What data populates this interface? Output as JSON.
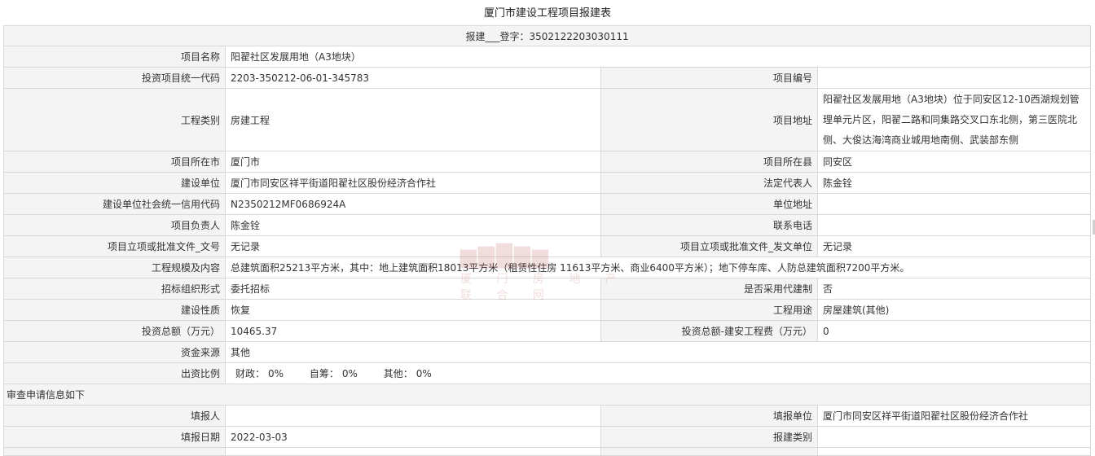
{
  "page_title": "厦门市建设工程项目报建表",
  "registration": "报建___登字：3502122203030111",
  "rows": {
    "project_name_label": "项目名称",
    "project_name": "阳翟社区发展用地（A3地块）",
    "invest_code_label": "投资项目统一代码",
    "invest_code": "2203-350212-06-01-345783",
    "project_no_label": "项目编号",
    "project_no": "",
    "category_label": "工程类别",
    "category": "房建工程",
    "address_label": "项目地址",
    "address": "阳翟社区发展用地（A3地块）位于同安区12-10西湖规划管理单元片区，阳翟二路和同集路交叉口东北侧，第三医院北侧、大俊达海湾商业城用地南侧、武装部东侧",
    "city_label": "项目所在市",
    "city": "厦门市",
    "county_label": "项目所在县",
    "county": "同安区",
    "builder_label": "建设单位",
    "builder": "厦门市同安区祥平街道阳翟社区股份经济合作社",
    "legal_rep_label": "法定代表人",
    "legal_rep": "陈金铨",
    "credit_code_label": "建设单位社会统一信用代码",
    "credit_code": "N2350212MF0686924A",
    "unit_address_label": "单位地址",
    "unit_address": "",
    "manager_label": "项目负责人",
    "manager": "陈金铨",
    "phone_label": "联系电话",
    "phone": "",
    "approval_doc_label": "项目立项或批准文件_文号",
    "approval_doc": "无记录",
    "approval_unit_label": "项目立项或批准文件_发文单位",
    "approval_unit": "无记录",
    "scale_label": "工程规模及内容",
    "scale": "总建筑面积25213平方米，其中：地上建筑面积18013平方米（租赁性住房 11613平方米、商业6400平方米）；地下停车库、人防总建筑面积7200平方米。",
    "bidding_label": "招标组织形式",
    "bidding": "委托招标",
    "agent_label": "是否采用代建制",
    "agent": "否",
    "nature_label": "建设性质",
    "nature": "恢复",
    "usage_label": "工程用途",
    "usage": "房屋建筑(其他)",
    "invest_total_label": "投资总额（万元）",
    "invest_total": "10465.37",
    "invest_build_label": "投资总额-建安工程费（万元）",
    "invest_build": "0",
    "fund_source_label": "资金来源",
    "fund_source": "其他",
    "ratio_label": "出资比例",
    "ratio_fin_label": "财政：",
    "ratio_fin": "0%",
    "ratio_self_label": "自筹：",
    "ratio_self": "0%",
    "ratio_other_label": "其他：",
    "ratio_other": "0%"
  },
  "review": {
    "section_title": "审查申请信息如下",
    "filler_label": "填报人",
    "filler": "",
    "filler_unit_label": "填报单位",
    "filler_unit": "厦门市同安区祥平街道阳翟社区股份经济合作社",
    "fill_date_label": "填报日期",
    "fill_date": "2022-03-03",
    "report_type_label": "报建类别",
    "report_type": ""
  },
  "watermark": {
    "text": "厦 门 房 地 产 联 合 网",
    "color": "#b43030"
  }
}
